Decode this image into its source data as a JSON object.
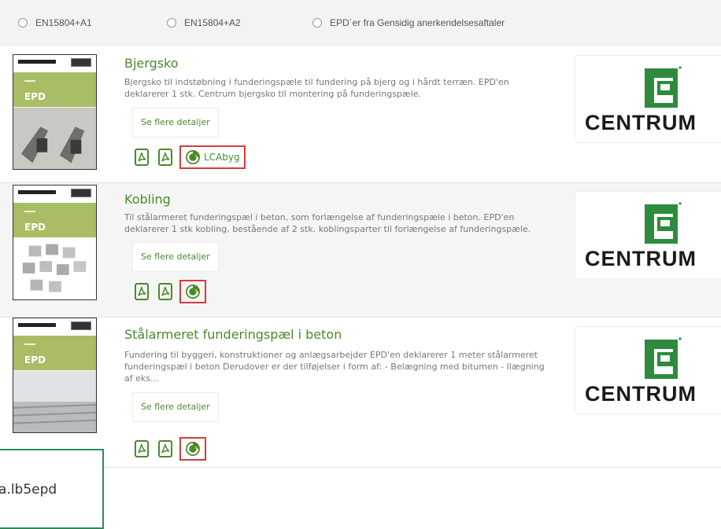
{
  "filters": [
    {
      "label": "EN15804+A1",
      "selected": false
    },
    {
      "label": "EN15804+A2",
      "selected": false
    },
    {
      "label": "EPD´er fra Gensidig anerkendelsesaftaler",
      "selected": false
    }
  ],
  "thumbnail": {
    "badge": "EPD"
  },
  "products": [
    {
      "title": "Bjergsko",
      "description": "Bjergsko til indstøbning i funderingspæle til fundering på bjerg og i hårdt terræn. EPD'en deklarerer 1 stk. Centrum bjergsko til montering på funderingspæle.",
      "details_label": "Se flere detaljer",
      "lca_label": "LCAbyg",
      "logo_text": "CENTRUM"
    },
    {
      "title": "Kobling",
      "description": "Til stålarmeret funderingspæl i beton, som forlængelse af funderingspæle i beton. EPD'en deklarerer 1 stk kobling, bestående af 2 stk. koblingsparter til forlængelse af funderingspæle.",
      "details_label": "Se flere detaljer",
      "lca_label": "",
      "logo_text": "CENTRUM"
    },
    {
      "title": "Stålarmeret funderingspæl i beton",
      "description": "Fundering til byggeri, konstruktioner og anlægsarbejder EPD'en deklarerer 1 meter stålarmeret funderingspæl i beton Derudover er der tilføjelser i form af: - Belægning med bitumen - Ilægning af eks...",
      "details_label": "Se flere detaljer",
      "lca_label": "",
      "logo_text": "CENTRUM"
    }
  ],
  "tooltip": {
    "text": "a.lb5epd"
  },
  "colors": {
    "accent_green": "#4a8a2d",
    "highlight_red": "#d63b3b",
    "epd_green": "#a9bd64",
    "tooltip_border": "#2e8b57"
  }
}
